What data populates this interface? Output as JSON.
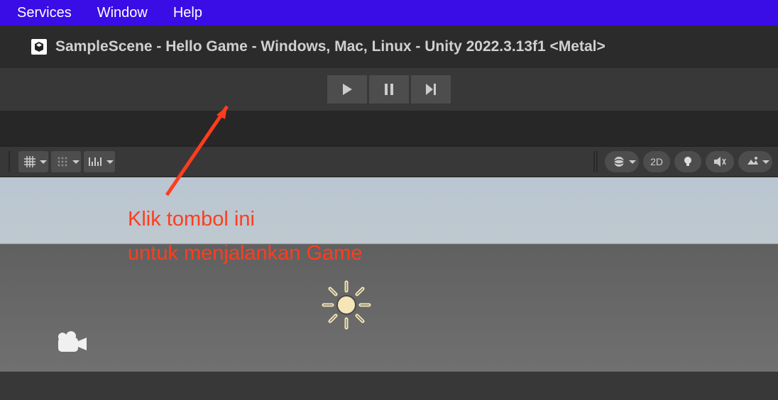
{
  "menubar": {
    "items": [
      "Services",
      "Window",
      "Help"
    ]
  },
  "titlebar": {
    "title": "SampleScene - Hello Game - Windows, Mac, Linux - Unity 2022.3.13f1 <Metal>"
  },
  "toolbar": {
    "twod_label": "2D"
  },
  "annotation": {
    "line1": "Klik tombol ini",
    "line2": "untuk menjalankan Game"
  }
}
